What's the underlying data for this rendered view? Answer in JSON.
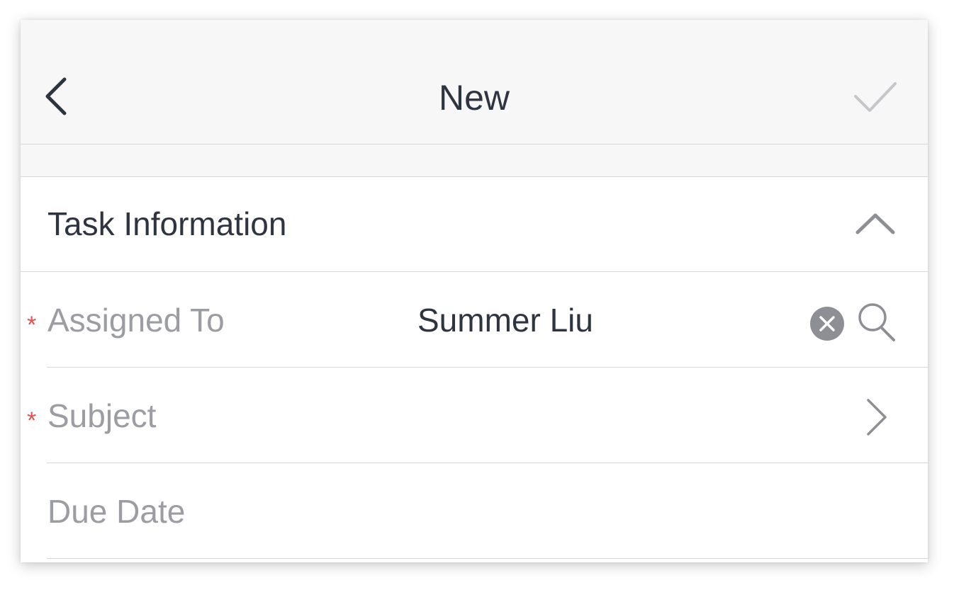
{
  "navbar": {
    "title": "New",
    "back_icon": "chevron-left-icon",
    "done_icon": "checkmark-icon"
  },
  "section": {
    "title": "Task Information",
    "toggle_icon": "chevron-up-icon"
  },
  "fields": {
    "assigned_to": {
      "required_mark": "*",
      "label": "Assigned To",
      "value": "Summer Liu",
      "clear_icon": "clear-icon",
      "search_icon": "search-icon"
    },
    "subject": {
      "required_mark": "*",
      "label": "Subject",
      "value": "",
      "open_icon": "chevron-right-icon"
    },
    "due_date": {
      "label": "Due Date",
      "value": ""
    }
  },
  "colors": {
    "title_text": "#2f3540",
    "label_text": "#9c9da3",
    "required": "#e4514f",
    "navbar_bg": "#f7f7f8",
    "divider": "#d6d6d9",
    "icon_gray": "#8e8f94",
    "done_disabled": "#c5c6ca"
  }
}
